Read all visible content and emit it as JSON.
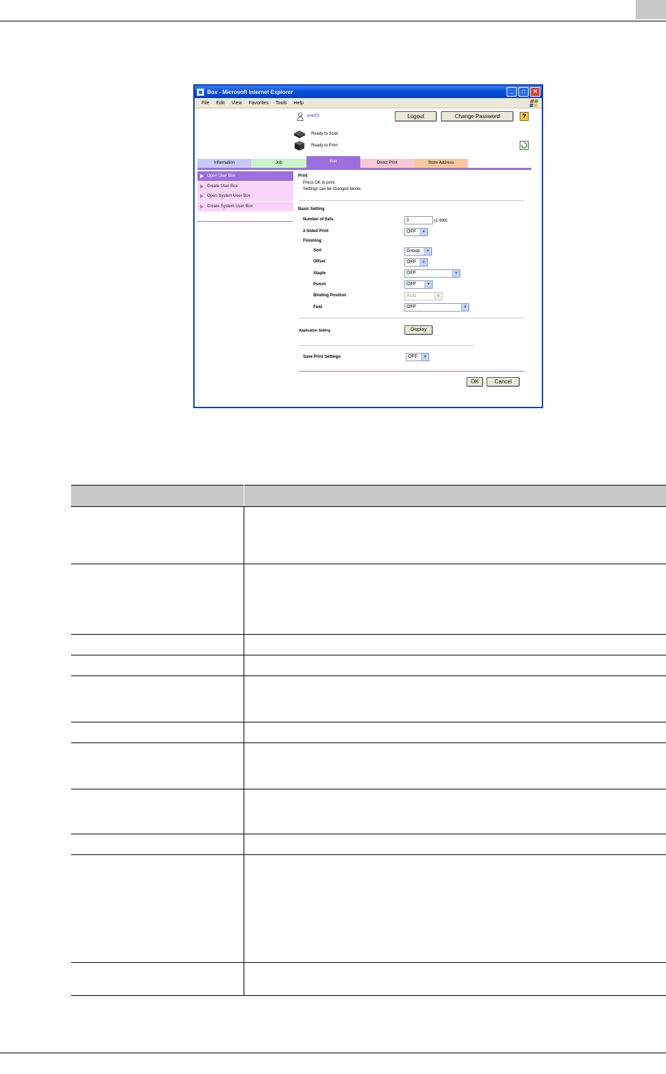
{
  "browser": {
    "title": "Box - Microsoft Internet Explorer",
    "controls": [
      "_",
      "□",
      "✕"
    ],
    "menu": [
      "File",
      "Edit",
      "View",
      "Favorites",
      "Tools",
      "Help"
    ]
  },
  "header": {
    "user": "user01",
    "logout_label": "Logout",
    "change_password_label": "Change Password",
    "help_label": "?",
    "status_scan": "Ready to Scan",
    "status_print": "Ready to Print"
  },
  "tabs": [
    {
      "label": "Information",
      "color": "#c8c8f8"
    },
    {
      "label": "Job",
      "color": "#c8f4c8"
    },
    {
      "label": "Box",
      "color": "#9b6fe0"
    },
    {
      "label": "Direct Print",
      "color": "#f8c8d4"
    },
    {
      "label": "Store Address",
      "color": "#f8c89a"
    }
  ],
  "left_menu": [
    "Open User Box",
    "Create User Box",
    "Open System User Box",
    "Create System User Box"
  ],
  "main": {
    "print_heading": "Print",
    "msg1": "Press OK to print.",
    "msg2": "Settings can be changed below.",
    "basic_setting": "Basic Setting",
    "number_of_sets_label": "Number of Sets",
    "number_of_sets_value": "1",
    "number_of_sets_range": "(1-999)",
    "two_sided_label": "2-Sided Print",
    "two_sided_value": "OFF",
    "finishing_label": "Finishing",
    "sort_label": "Sort",
    "sort_value": "Group",
    "offset_label": "Offset",
    "offset_value": "OFF",
    "staple_label": "Staple",
    "staple_value": "OFF",
    "punch_label": "Punch",
    "punch_value": "OFF",
    "binding_label": "Binding Position",
    "binding_value": "Auto",
    "fold_label": "Fold",
    "fold_value": "OFF",
    "application_setting_label": "Application Setting",
    "display_label": "Display",
    "save_print_label": "Save Print Settings",
    "save_print_value": "OFF",
    "ok_label": "OK",
    "cancel_label": "Cancel"
  },
  "table": {
    "headers": [
      "",
      ""
    ],
    "rows": 11
  }
}
